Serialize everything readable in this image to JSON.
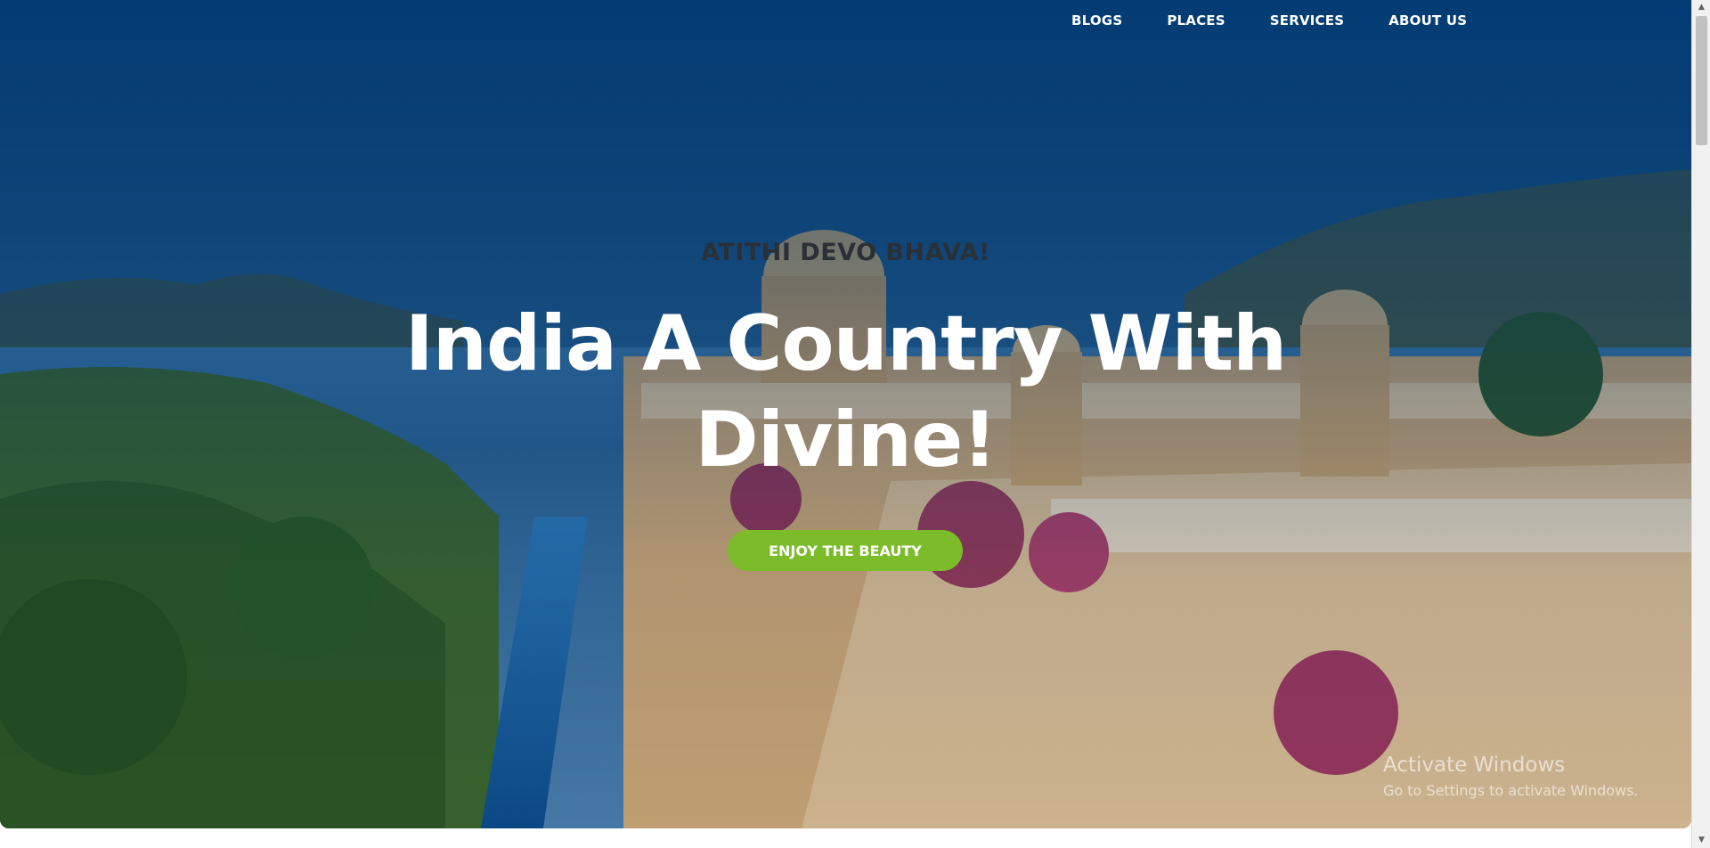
{
  "nav": {
    "items": [
      {
        "label": "BLOGS"
      },
      {
        "label": "PLACES"
      },
      {
        "label": "SERVICES"
      },
      {
        "label": "ABOUT US"
      }
    ]
  },
  "hero": {
    "kicker": "ATITHI DEVO BHAVA!",
    "headline_line1": "India A Country With",
    "headline_line2": "Divine!",
    "cta_label": "ENJOY THE BEAUTY"
  },
  "watermark": {
    "title": "Activate Windows",
    "subtitle": "Go to Settings to activate Windows."
  },
  "scrollbar": {
    "up_icon": "▲",
    "down_icon": "▼"
  },
  "colors": {
    "accent": "#7cbb2a",
    "sky": "#0b4f86",
    "text_dark": "#2a3036"
  }
}
